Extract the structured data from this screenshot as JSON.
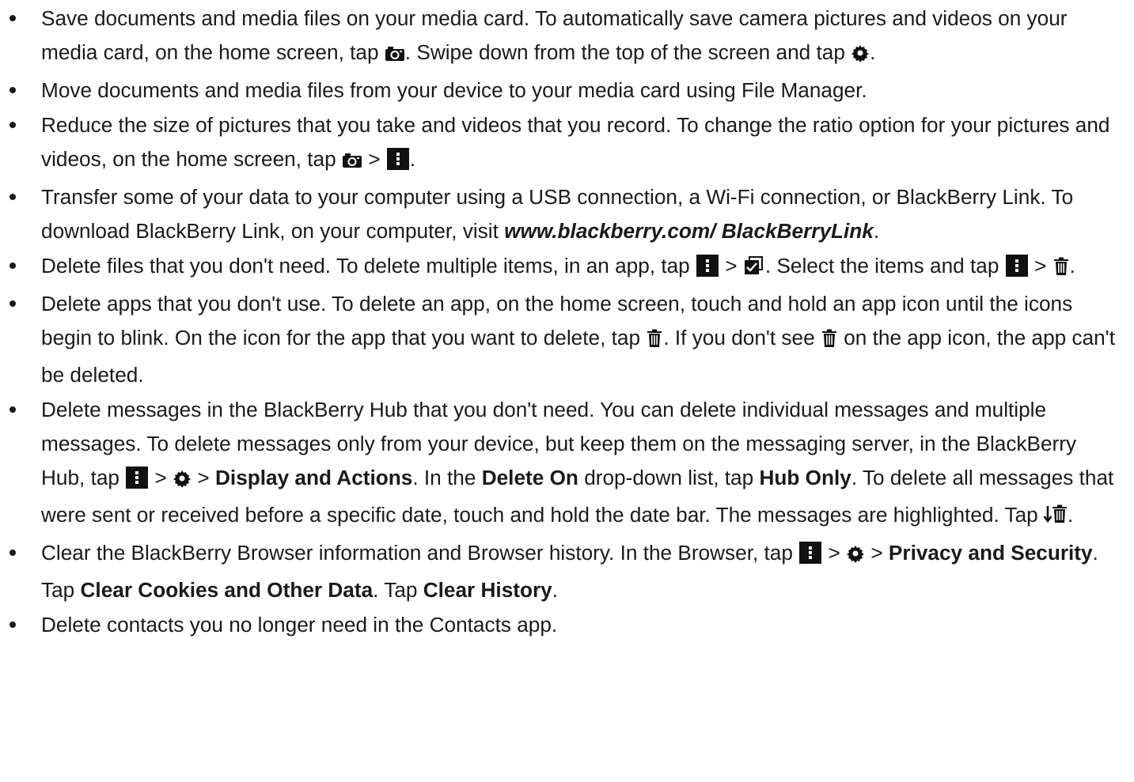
{
  "icons": {
    "camera": "camera-icon",
    "settings": "gear-icon",
    "menu": "more-actions-icon",
    "select": "select-items-icon",
    "trash": "trash-icon",
    "delete_prior": "delete-prior-icon"
  },
  "items": [
    {
      "t1": "Save documents and media files on your media card. To automatically save camera pictures and videos on your media card, on the home screen, tap ",
      "t2": ". Swipe down from the top of the screen and tap ",
      "t3": "."
    },
    {
      "t1": "Move documents and media files from your device to your media card using File Manager."
    },
    {
      "t1": "Reduce the size of pictures that you take and videos that you record. To change the ratio option for your pictures and videos, on the home screen, tap ",
      "t2": " > ",
      "t3": "."
    },
    {
      "t1": "Transfer some of your data to your computer using a USB connection, a Wi-Fi connection, or BlackBerry Link. To download BlackBerry Link, on your computer, visit ",
      "link": "www.blackberry.com/ BlackBerryLink",
      "t2": "."
    },
    {
      "t1": "Delete files that you don't need. To delete multiple items, in an app, tap ",
      "t2": " > ",
      "t3": ". Select the items and tap ",
      "t4": " > ",
      "t5": "."
    },
    {
      "t1": "Delete apps that you don't use. To delete an app, on the home screen, touch and hold an app icon until the icons begin to blink. On the icon for the app that you want to delete, tap ",
      "t2": ". If you don't see ",
      "t3": " on the app icon, the app can't be deleted."
    },
    {
      "t1": "Delete messages in the BlackBerry Hub that you don't need. You can delete individual messages and multiple messages. To delete messages only from your device, but keep them on the messaging server, in the BlackBerry Hub, tap ",
      "t2": " > ",
      "t3": " > ",
      "b1": "Display and Actions",
      "t4": ". In the ",
      "b2": "Delete On",
      "t5": " drop-down list, tap ",
      "b3": "Hub Only",
      "t6": ". To delete all messages that were sent or received before a specific date, touch and hold the date bar. The messages are highlighted. Tap ",
      "t7": "."
    },
    {
      "t1": "Clear the BlackBerry Browser information and Browser history. In the Browser, tap ",
      "t2": " > ",
      "t3": " > ",
      "b1": "Privacy and Security",
      "t4": ". Tap ",
      "b2": "Clear Cookies and Other Data",
      "t5": ". Tap ",
      "b3": "Clear History",
      "t6": "."
    },
    {
      "t1": "Delete contacts you no longer need in the Contacts app."
    }
  ]
}
